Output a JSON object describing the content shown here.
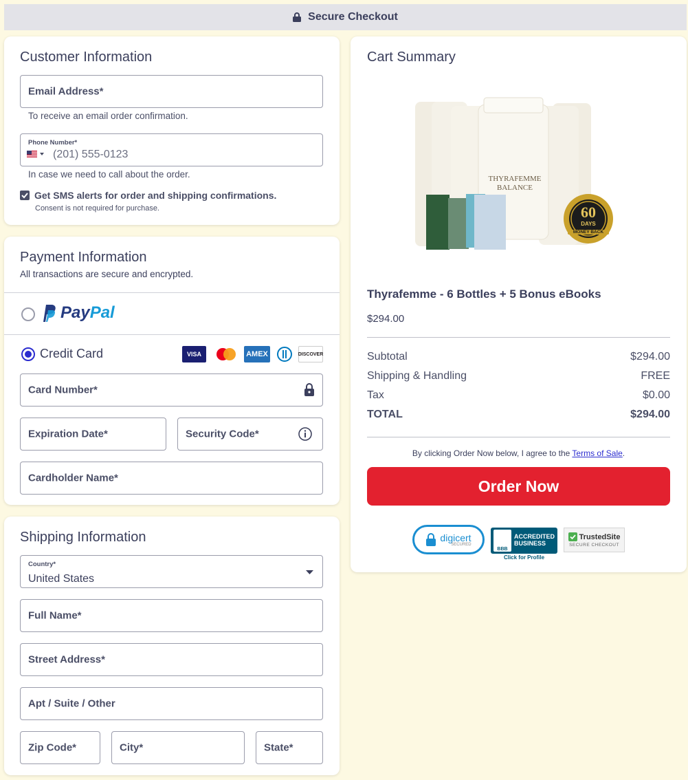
{
  "header": {
    "title": "Secure Checkout",
    "icon": "lock-icon"
  },
  "customer": {
    "title": "Customer Information",
    "email_label": "Email Address*",
    "email_hint": "To receive an email order confirmation.",
    "phone_label": "Phone Number*",
    "phone_placeholder": "(201) 555-0123",
    "phone_hint": "In case we need to call about the order.",
    "sms_label": "Get SMS alerts for order and shipping confirmations.",
    "sms_checked": true,
    "sms_consent": "Consent is not required for purchase."
  },
  "payment": {
    "title": "Payment Information",
    "subtitle": "All transactions are secure and encrypted.",
    "paypal_pay": "Pay",
    "paypal_pal": "Pal",
    "credit_card_label": "Credit Card",
    "selected": "Credit Card",
    "card_brands": [
      "VISA",
      "Mastercard",
      "AMEX",
      "Diners",
      "DISCOVER"
    ],
    "card_number_label": "Card Number*",
    "expiration_label": "Expiration Date*",
    "security_code_label": "Security Code*",
    "cardholder_label": "Cardholder Name*"
  },
  "shipping": {
    "title": "Shipping Information",
    "country_label": "Country*",
    "country_value": "United States",
    "full_name_label": "Full Name*",
    "street_label": "Street Address*",
    "apt_label": "Apt / Suite / Other",
    "zip_label": "Zip Code*",
    "city_label": "City*",
    "state_label": "State*"
  },
  "cart": {
    "title": "Cart Summary",
    "product_name": "Thyrafemme - 6 Bottles + 5 Bonus eBooks",
    "product_price": "$294.00",
    "product_bottle_text": "THYRAFEMME BALANCE",
    "seal_number": "60",
    "seal_days": "DAYS",
    "seal_text": "MONEY BACK",
    "subtotal_label": "Subtotal",
    "subtotal_value": "$294.00",
    "shipping_label": "Shipping & Handling",
    "shipping_value": "FREE",
    "tax_label": "Tax",
    "tax_value": "$0.00",
    "total_label": "TOTAL",
    "total_value": "$294.00",
    "terms_prefix": "By clicking Order Now below, I agree to the ",
    "terms_link": "Terms of Sale",
    "terms_suffix": ".",
    "order_button": "Order Now",
    "badges": {
      "digicert": "digicert",
      "digicert_sub": "SECURED",
      "bbb_line1": "ACCREDITED",
      "bbb_line2": "BUSINESS",
      "bbb_mark": "BBB",
      "bbb_profile": "Click for Profile",
      "trustedsite": "TrustedSite",
      "trustedsite_sub": "SECURE CHECKOUT"
    }
  },
  "colors": {
    "background": "#fdf9e2",
    "accent_red": "#e3212f",
    "radio_blue": "#2b2ccf",
    "paypal_dark": "#253b80",
    "paypal_light": "#179bd7"
  }
}
